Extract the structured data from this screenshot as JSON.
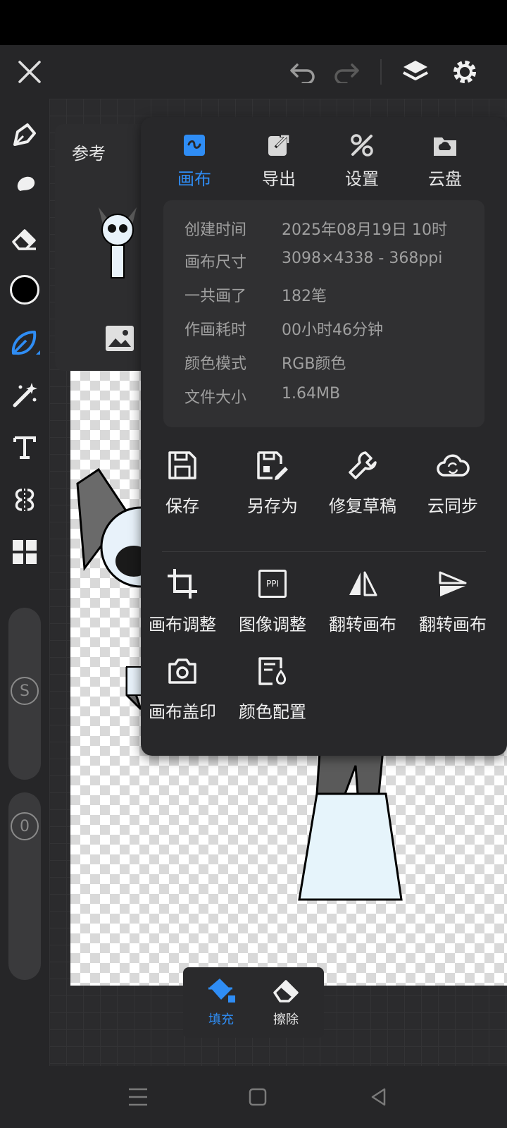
{
  "topbar": {
    "close_icon": "close-icon",
    "undo_icon": "undo-icon",
    "redo_icon": "redo-icon",
    "layers_icon": "layers-icon",
    "settings_icon": "gear-icon"
  },
  "reference_panel": {
    "title": "参考"
  },
  "popup": {
    "tabs": [
      {
        "label": "画布",
        "icon": "canvas-icon",
        "active": true
      },
      {
        "label": "导出",
        "icon": "export-icon",
        "active": false
      },
      {
        "label": "设置",
        "icon": "settings-tools-icon",
        "active": false
      },
      {
        "label": "云盘",
        "icon": "cloud-drive-icon",
        "active": false
      }
    ],
    "info": [
      {
        "key": "创建时间",
        "value": "2025年08月19日 10时"
      },
      {
        "key": "画布尺寸",
        "value": "3098×4338 - 368ppi"
      },
      {
        "key": "一共画了",
        "value": "182笔"
      },
      {
        "key": "作画耗时",
        "value": "00小时46分钟"
      },
      {
        "key": "颜色模式",
        "value": "RGB颜色"
      },
      {
        "key": "文件大小",
        "value": "1.64MB"
      }
    ],
    "actions_row1": [
      {
        "label": "保存",
        "icon": "save-icon"
      },
      {
        "label": "另存为",
        "icon": "save-as-icon"
      },
      {
        "label": "修复草稿",
        "icon": "wrench-icon"
      },
      {
        "label": "云同步",
        "icon": "cloud-sync-icon"
      }
    ],
    "actions_row2": [
      {
        "label": "画布调整",
        "icon": "crop-icon"
      },
      {
        "label": "图像调整",
        "icon": "ppi-icon",
        "badge": "PPI"
      },
      {
        "label": "翻转画布",
        "icon": "flip-horizontal-icon"
      },
      {
        "label": "翻转画布",
        "icon": "flip-vertical-icon"
      }
    ],
    "actions_row3": [
      {
        "label": "画布盖印",
        "icon": "camera-icon"
      },
      {
        "label": "颜色配置",
        "icon": "color-config-icon"
      }
    ]
  },
  "left_toolbar": {
    "size_slider_label": "S",
    "opacity_slider_label": "0"
  },
  "bottom_tools": [
    {
      "label": "填充",
      "icon": "fill-bucket-icon",
      "active": true
    },
    {
      "label": "擦除",
      "icon": "eraser-icon",
      "active": false
    }
  ],
  "colors": {
    "accent": "#2f8df5",
    "current_color": "#000000"
  }
}
